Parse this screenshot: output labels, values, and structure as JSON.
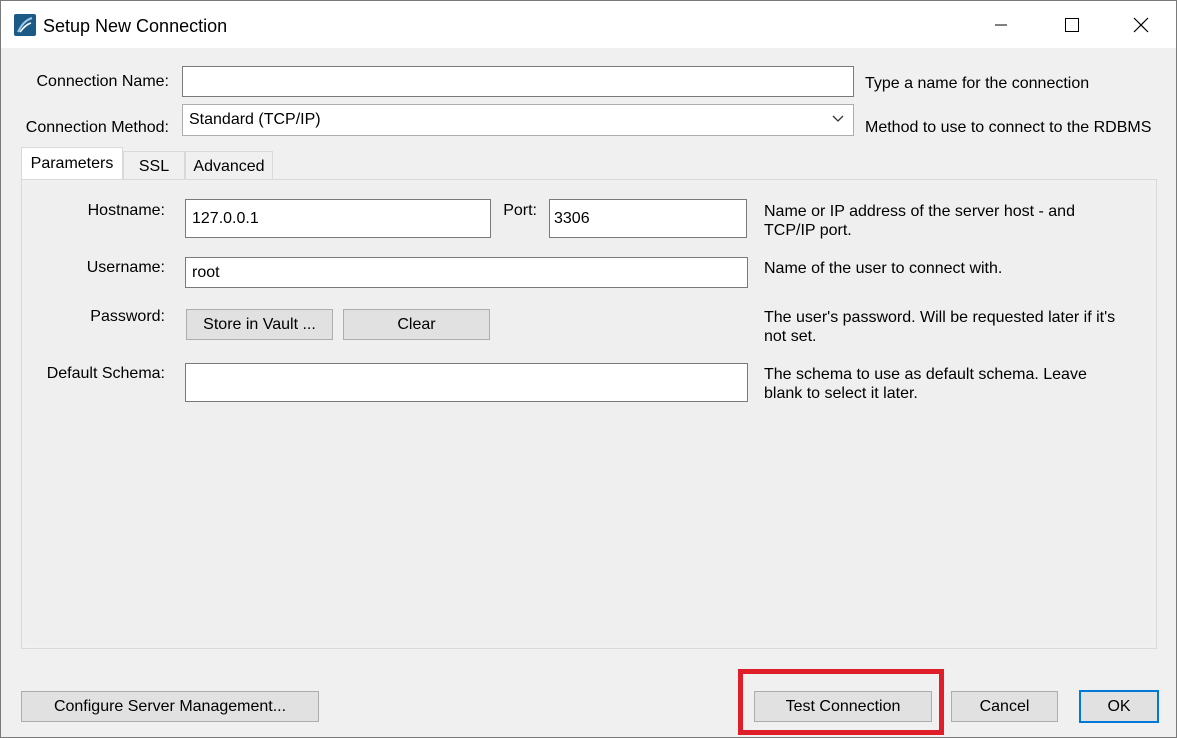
{
  "window": {
    "title": "Setup New Connection",
    "icon": "mysql-workbench-icon",
    "controls": [
      "minimize-icon",
      "maximize-icon",
      "close-icon"
    ]
  },
  "form": {
    "connection_name": {
      "label": "Connection Name:",
      "value": "",
      "hint": "Type a name for the connection"
    },
    "connection_method": {
      "label": "Connection Method:",
      "value": "Standard (TCP/IP)",
      "hint": "Method to use to connect to the RDBMS"
    }
  },
  "tabs": [
    {
      "label": "Parameters",
      "active": true
    },
    {
      "label": "SSL",
      "active": false
    },
    {
      "label": "Advanced",
      "active": false
    }
  ],
  "parameters": {
    "hostname": {
      "label": "Hostname:",
      "value": "127.0.0.1"
    },
    "port": {
      "label": "Port:",
      "value": "3306"
    },
    "hostname_hint_line1": "Name or IP address of the server host - and",
    "hostname_hint_line2": "TCP/IP port.",
    "username": {
      "label": "Username:",
      "value": "root",
      "hint": "Name of the user to connect with."
    },
    "password": {
      "label": "Password:",
      "store_button": "Store in Vault ...",
      "clear_button": "Clear",
      "hint_line1": "The user's password. Will be requested later if it's",
      "hint_line2": "not set."
    },
    "default_schema": {
      "label": "Default Schema:",
      "value": "",
      "hint_line1": "The schema to use as default schema. Leave",
      "hint_line2": "blank to select it later."
    }
  },
  "footer": {
    "configure_button": "Configure Server Management...",
    "test_button": "Test Connection",
    "cancel_button": "Cancel",
    "ok_button": "OK"
  },
  "colors": {
    "highlight": "#e01e2a",
    "default_button_border": "#0078d7"
  }
}
